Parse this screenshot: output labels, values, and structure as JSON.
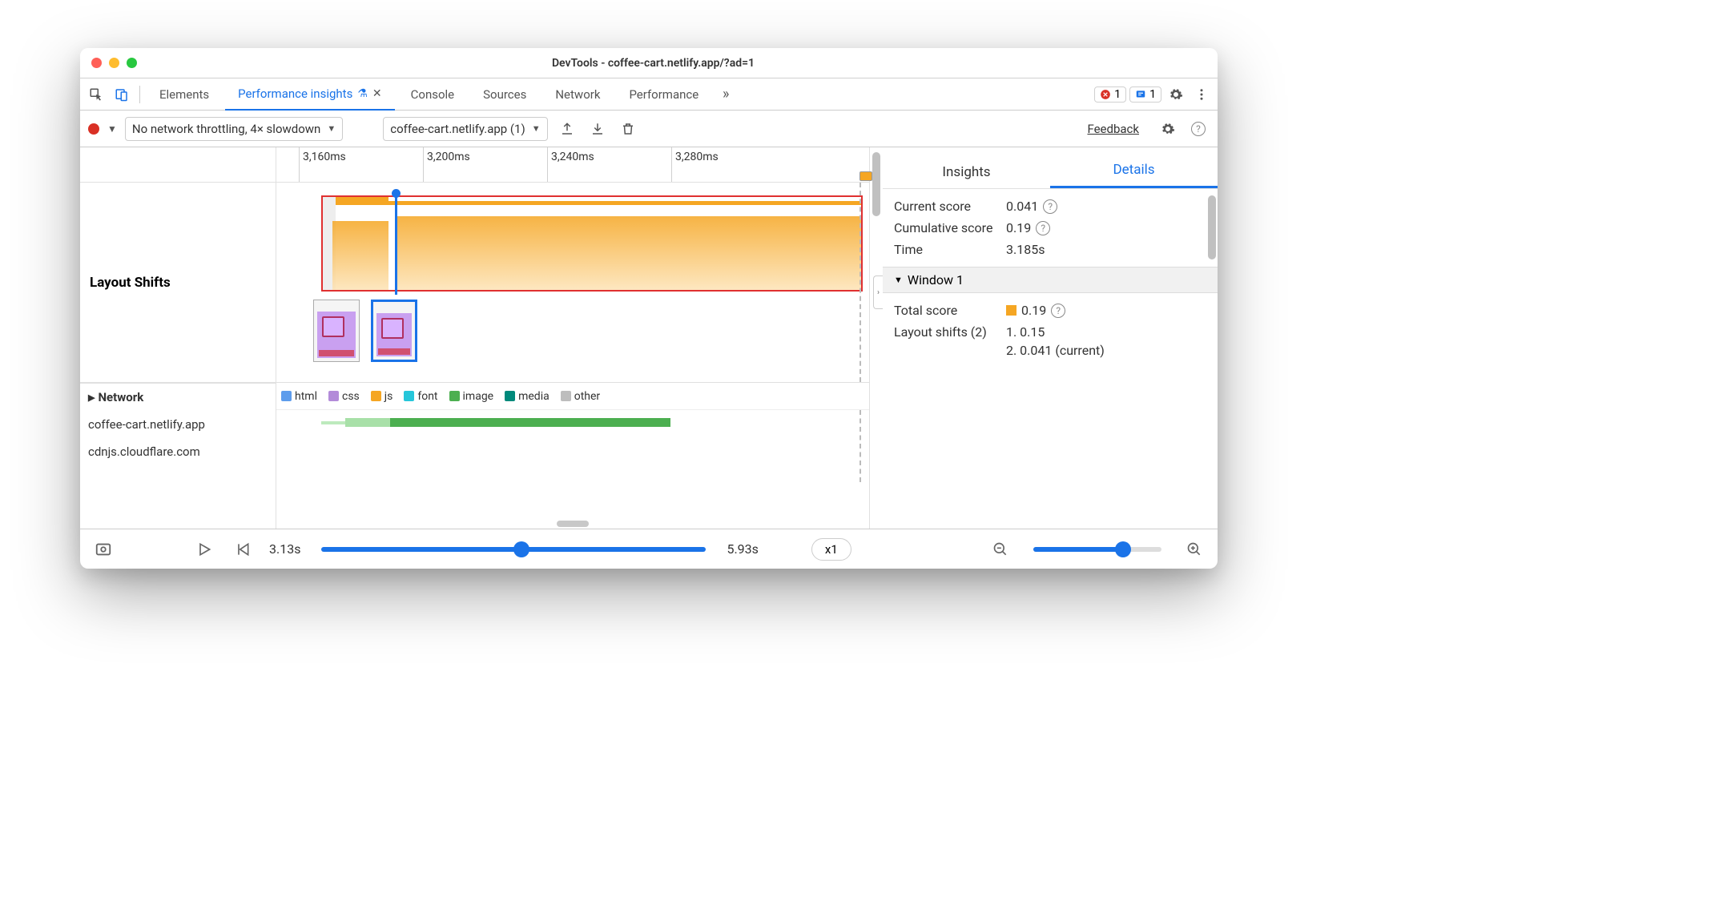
{
  "window_title": "DevTools - coffee-cart.netlify.app/?ad=1",
  "tabs": [
    "Elements",
    "Performance insights",
    "Console",
    "Sources",
    "Network",
    "Performance"
  ],
  "active_tab_index": 1,
  "error_badge_count": "1",
  "issue_badge_count": "1",
  "toolbar": {
    "throttle": "No network throttling, 4× slowdown",
    "recording": "coffee-cart.netlify.app (1)",
    "feedback": "Feedback"
  },
  "timeline_ticks": [
    "3,160ms",
    "3,200ms",
    "3,240ms",
    "3,280ms"
  ],
  "lanes": {
    "layout_shifts_label": "Layout Shifts",
    "network_label": "Network"
  },
  "legend": {
    "html": "html",
    "css": "css",
    "js": "js",
    "font": "font",
    "image": "image",
    "media": "media",
    "other": "other"
  },
  "net_domains": [
    "coffee-cart.netlify.app",
    "cdnjs.cloudflare.com"
  ],
  "right": {
    "tab_insights": "Insights",
    "tab_details": "Details",
    "current_score_label": "Current score",
    "current_score_value": "0.041",
    "cumulative_label": "Cumulative score",
    "cumulative_value": "0.19",
    "time_label": "Time",
    "time_value": "3.185s",
    "window_header": "Window 1",
    "total_score_label": "Total score",
    "total_score_value": "0.19",
    "layout_shifts_label": "Layout shifts (2)",
    "shift1": "1. 0.15",
    "shift2": "2. 0.041 (current)"
  },
  "footer": {
    "start": "3.13s",
    "end": "5.93s",
    "speed": "x1"
  }
}
